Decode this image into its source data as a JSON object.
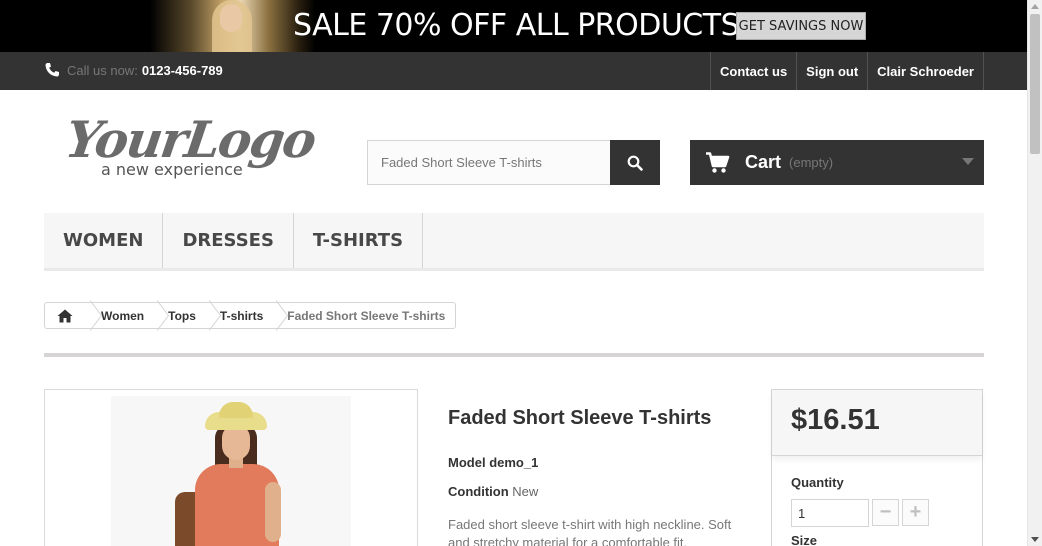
{
  "promo": {
    "headline": "SALE 70% OFF ALL PRODUCTS",
    "cta_label": "GET SAVINGS NOW"
  },
  "topbar": {
    "phone_prefix": "Call us now:",
    "phone_number": "0123-456-789",
    "links": [
      "Contact us",
      "Sign out",
      "Clair Schroeder"
    ]
  },
  "header": {
    "logo_main": "YourLogo",
    "logo_sub": "a new experience",
    "search_value": "Faded Short Sleeve T-shirts",
    "cart_label": "Cart",
    "cart_status": "(empty)"
  },
  "menu": {
    "items": [
      "WOMEN",
      "DRESSES",
      "T-SHIRTS"
    ]
  },
  "breadcrumb": {
    "items": [
      "Women",
      "Tops",
      "T-shirts"
    ],
    "current": "Faded Short Sleeve T-shirts"
  },
  "product": {
    "name": "Faded Short Sleeve T-shirts",
    "model_label": "Model",
    "model_value": "demo_1",
    "condition_label": "Condition",
    "condition_value": "New",
    "description": "Faded short sleeve t-shirt with high neckline. Soft and stretchy material for a comfortable fit."
  },
  "buy_box": {
    "price": "$16.51",
    "quantity_label": "Quantity",
    "quantity_value": "1",
    "minus_label": "−",
    "plus_label": "+",
    "size_label": "Size"
  },
  "colors": {
    "dark_bar": "#333333",
    "menu_bg": "#f6f6f6",
    "border": "#d6d4d4"
  }
}
